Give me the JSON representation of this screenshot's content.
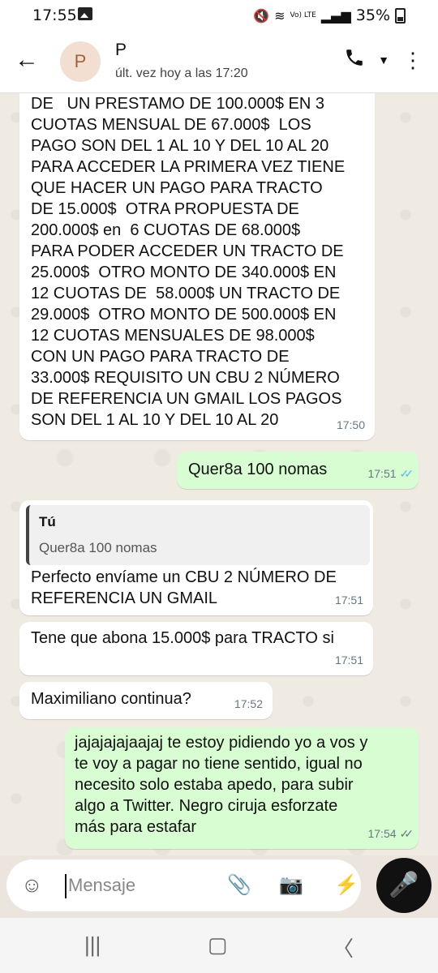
{
  "status_bar": {
    "time": "17:55",
    "network": "Vo) LTE",
    "battery": "35%"
  },
  "header": {
    "avatar_letter": "P",
    "name": "P",
    "status": "últ. vez hoy a las 17:20"
  },
  "messages": [
    {
      "dir": "in",
      "text": "DE   UN PRESTAMO DE 100.000$ EN 3\nCUOTAS MENSUAL DE 67.000$  LOS\nPAGO SON DEL 1 AL 10 Y DEL 10 AL 20\nPARA ACCEDER LA PRIMERA VEZ TIENE\nQUE HACER UN PAGO PARA TRACTO\nDE 15.000$  OTRA PROPUESTA DE\n200.000$ en  6 CUOTAS DE 68.000$\nPARA PODER ACCEDER UN TRACTO DE\n25.000$  OTRO MONTO DE 340.000$ EN\n12 CUOTAS DE  58.000$ UN TRACTO DE\n29.000$  OTRO MONTO DE 500.000$ EN\n12 CUOTAS MENSUALES DE 98.000$\nCON UN PAGO PARA TRACTO DE\n33.000$ REQUISITO UN CBU 2 NÚMERO\nDE REFERENCIA UN GMAIL LOS PAGOS\nSON DEL 1 AL 10 Y DEL 10 AL 20",
      "time": "17:50"
    },
    {
      "dir": "out",
      "text": "Quer8a 100 nomas",
      "time": "17:51",
      "read": true
    },
    {
      "dir": "in",
      "reply_to": {
        "name": "Tú",
        "text": "Quer8a 100 nomas"
      },
      "text": "Perfecto envíame un CBU 2 NÚMERO DE\nREFERENCIA UN GMAIL",
      "time": "17:51"
    },
    {
      "dir": "in",
      "text": "Tene que abona 15.000$ para TRACTO si",
      "time": "17:51"
    },
    {
      "dir": "in",
      "text": "Maximiliano continua?",
      "time": "17:52"
    },
    {
      "dir": "out",
      "text": "jajajajajaajaj te estoy pidiendo yo a vos y\nte voy a pagar no tiene sentido, igual no\nnecesito solo estaba apedo, para subir\nalgo a Twitter. Negro ciruja esforzate\nmás para estafar",
      "time": "17:54",
      "read": false
    }
  ],
  "composer": {
    "placeholder": "Mensaje"
  },
  "icons": {
    "back": "arrow-left-icon",
    "call": "phone-icon",
    "menu": "more-vert-icon",
    "emoji": "sticker-icon",
    "attach": "paperclip-icon",
    "camera": "camera-icon",
    "bolt": "lightning-icon",
    "mic": "microphone-icon"
  },
  "colors": {
    "incoming": "#ffffff",
    "outgoing": "#d9fdd3",
    "tick_read": "#53bdeb",
    "background": "#efeae2"
  }
}
